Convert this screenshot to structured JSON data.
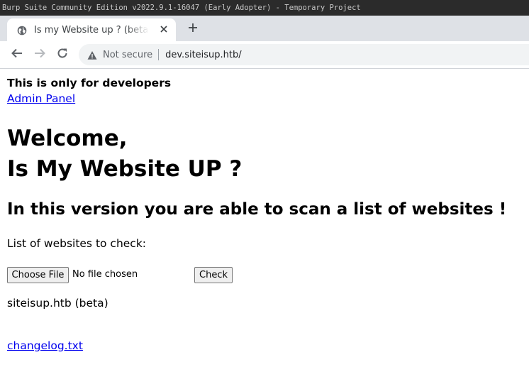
{
  "window": {
    "title": "Burp Suite Community Edition v2022.9.1-16047 (Early Adopter) - Temporary Project"
  },
  "tabs": [
    {
      "title": "Is my Website up ? (beta version)",
      "icon": "globe-icon",
      "active": true
    }
  ],
  "toolbar": {
    "back_icon": "arrow-left-icon",
    "forward_icon": "arrow-right-icon",
    "reload_icon": "reload-icon",
    "security_label": "Not secure",
    "url": "dev.siteisup.htb/"
  },
  "page": {
    "dev_note": "This is only for developers",
    "admin_link": "Admin Panel",
    "heading_line1": "Welcome,",
    "heading_line2": "Is My Website UP ?",
    "subheading": "In this version you are able to scan a list of websites !",
    "list_label": "List of websites to check:",
    "choose_file_label": "Choose File",
    "no_file_text": "No file chosen",
    "check_label": "Check",
    "footer_text": "siteisup.htb (beta)",
    "changelog_link": "changelog.txt"
  },
  "colors": {
    "link": "#0000ee",
    "titlebar_bg": "#2b2b2b",
    "tabstrip_bg": "#dee1e6",
    "omnibox_bg": "#f1f3f4"
  }
}
